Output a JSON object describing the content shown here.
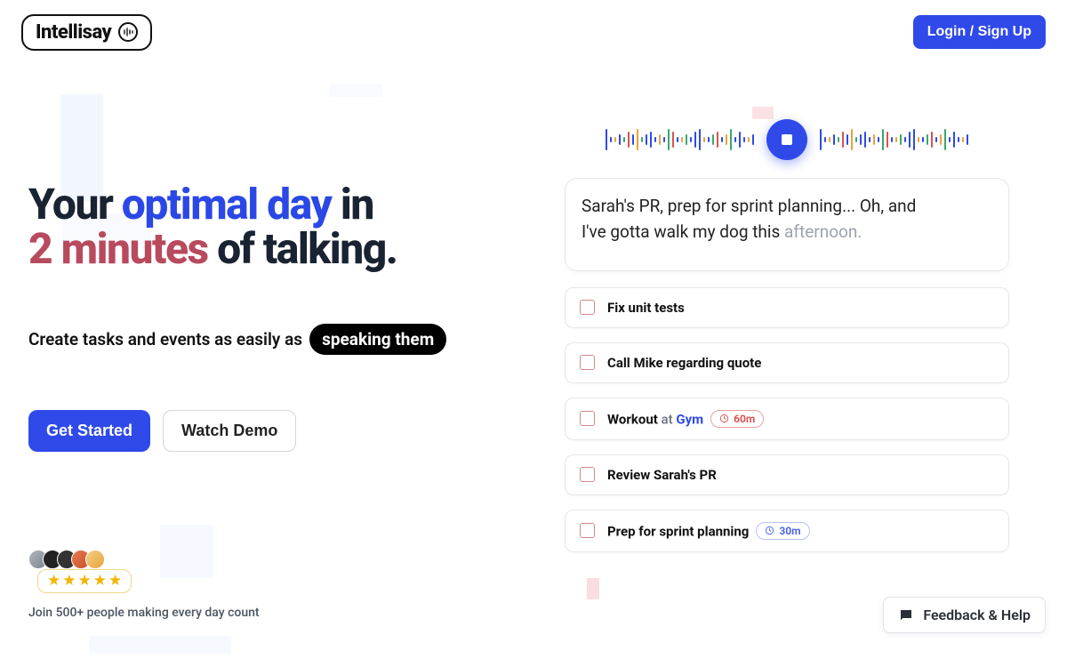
{
  "header": {
    "brand": "Intellisay",
    "login_label": "Login / Sign Up"
  },
  "hero": {
    "h_pre": "Your ",
    "h_blue": "optimal day",
    "h_mid": " in ",
    "h_red": "2 minutes",
    "h_post": " of talking.",
    "sub_pre": "Create tasks and events as easily as",
    "sub_pill": "speaking them",
    "cta_primary": "Get Started",
    "cta_secondary": "Watch Demo"
  },
  "social": {
    "stars": 5,
    "text": "Join 500+ people making every day count"
  },
  "transcript": {
    "line1": "Sarah's PR, prep for sprint planning... Oh, and",
    "line2a": "I've gotta walk my dog this ",
    "line2b": "afternoon."
  },
  "tasks": [
    {
      "title": "Fix unit tests"
    },
    {
      "title": "Call Mike regarding quote"
    },
    {
      "title": "Workout",
      "at": "at",
      "place": "Gym",
      "chip": {
        "kind": "orange",
        "text": "60m"
      }
    },
    {
      "title": "Review Sarah's PR"
    },
    {
      "title": "Prep for sprint planning",
      "chip": {
        "kind": "blue",
        "text": "30m"
      }
    }
  ],
  "feedback": {
    "label": "Feedback & Help"
  }
}
